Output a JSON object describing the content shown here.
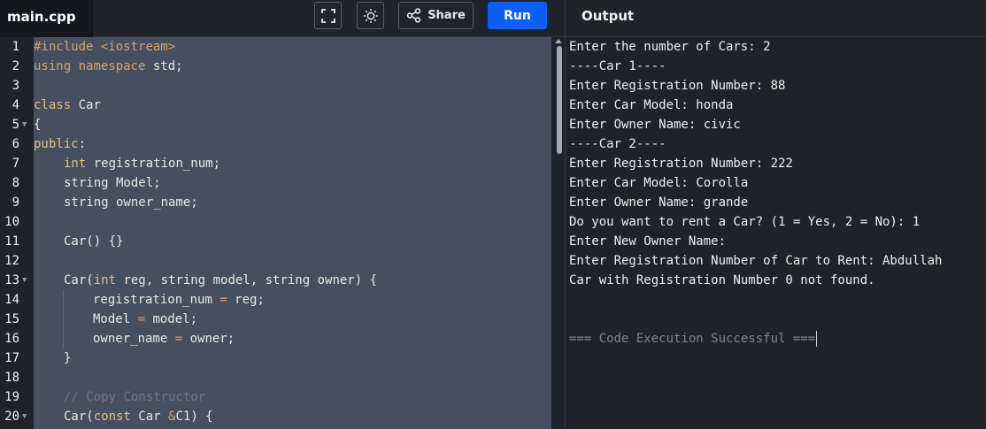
{
  "header": {
    "file_tab": "main.cpp",
    "share_label": "Share",
    "run_label": "Run",
    "output_title": "Output"
  },
  "editor": {
    "line_numbers": [
      "1",
      "2",
      "3",
      "4",
      "5",
      "6",
      "7",
      "8",
      "9",
      "10",
      "11",
      "12",
      "13",
      "14",
      "15",
      "16",
      "17",
      "18",
      "19",
      "20"
    ],
    "l1": {
      "pre": "#include",
      "inc": "<iostream>"
    },
    "l2": {
      "a": "using",
      "b": "namespace",
      "c": " std;"
    },
    "l4": {
      "a": "class",
      "b": " Car"
    },
    "l5": "{",
    "l6": {
      "a": "public",
      "b": ":"
    },
    "l7": {
      "a": "int",
      "b": " registration_num;"
    },
    "l8": "string Model;",
    "l9": "string owner_name;",
    "l11": "Car() {}",
    "l13": {
      "a": "Car(",
      "b": "int",
      "c": " reg, string model, string owner) {"
    },
    "l14": {
      "a": "registration_num ",
      "b": "=",
      "c": " reg;"
    },
    "l15": {
      "a": "Model ",
      "b": "=",
      "c": " model;"
    },
    "l16": {
      "a": "owner_name ",
      "b": "=",
      "c": " owner;"
    },
    "l17": "}",
    "l19": "// Copy Constructor",
    "l20": {
      "a": "Car(",
      "b": "const",
      "c": " Car ",
      "d": "&",
      "e": "C1) {"
    }
  },
  "output": {
    "lines": [
      "Enter the number of Cars: 2",
      "----Car 1----",
      "Enter Registration Number: 88",
      "Enter Car Model: honda",
      "Enter Owner Name: civic",
      "----Car 2----",
      "Enter Registration Number: 222",
      "Enter Car Model: Corolla",
      "Enter Owner Name: grande",
      "Do you want to rent a Car? (1 = Yes, 2 = No): 1",
      "Enter New Owner Name:",
      "Enter Registration Number of Car to Rent: Abdullah",
      "Car with Registration Number 0 not found.",
      "",
      "",
      "=== Code Execution Successful ==="
    ]
  },
  "colors": {
    "run_button": "#0d5ff5",
    "editor_bg": "#464f5f",
    "output_bg": "#1d232d",
    "keyword": "#e5c07b",
    "operator": "#d6a26c",
    "comment": "#6d7685"
  },
  "icons": [
    "fullscreen-icon",
    "theme-sun-icon",
    "share-icon",
    "fold-arrow-icon"
  ]
}
